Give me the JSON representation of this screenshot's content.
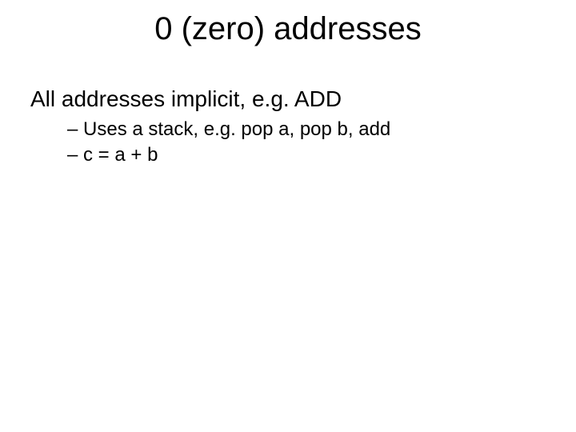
{
  "title": "0 (zero) addresses",
  "body": {
    "line1": "All addresses implicit, e.g. ADD",
    "bullets": [
      "Uses a stack, e.g. pop a, pop b, add",
      "c = a + b"
    ]
  }
}
